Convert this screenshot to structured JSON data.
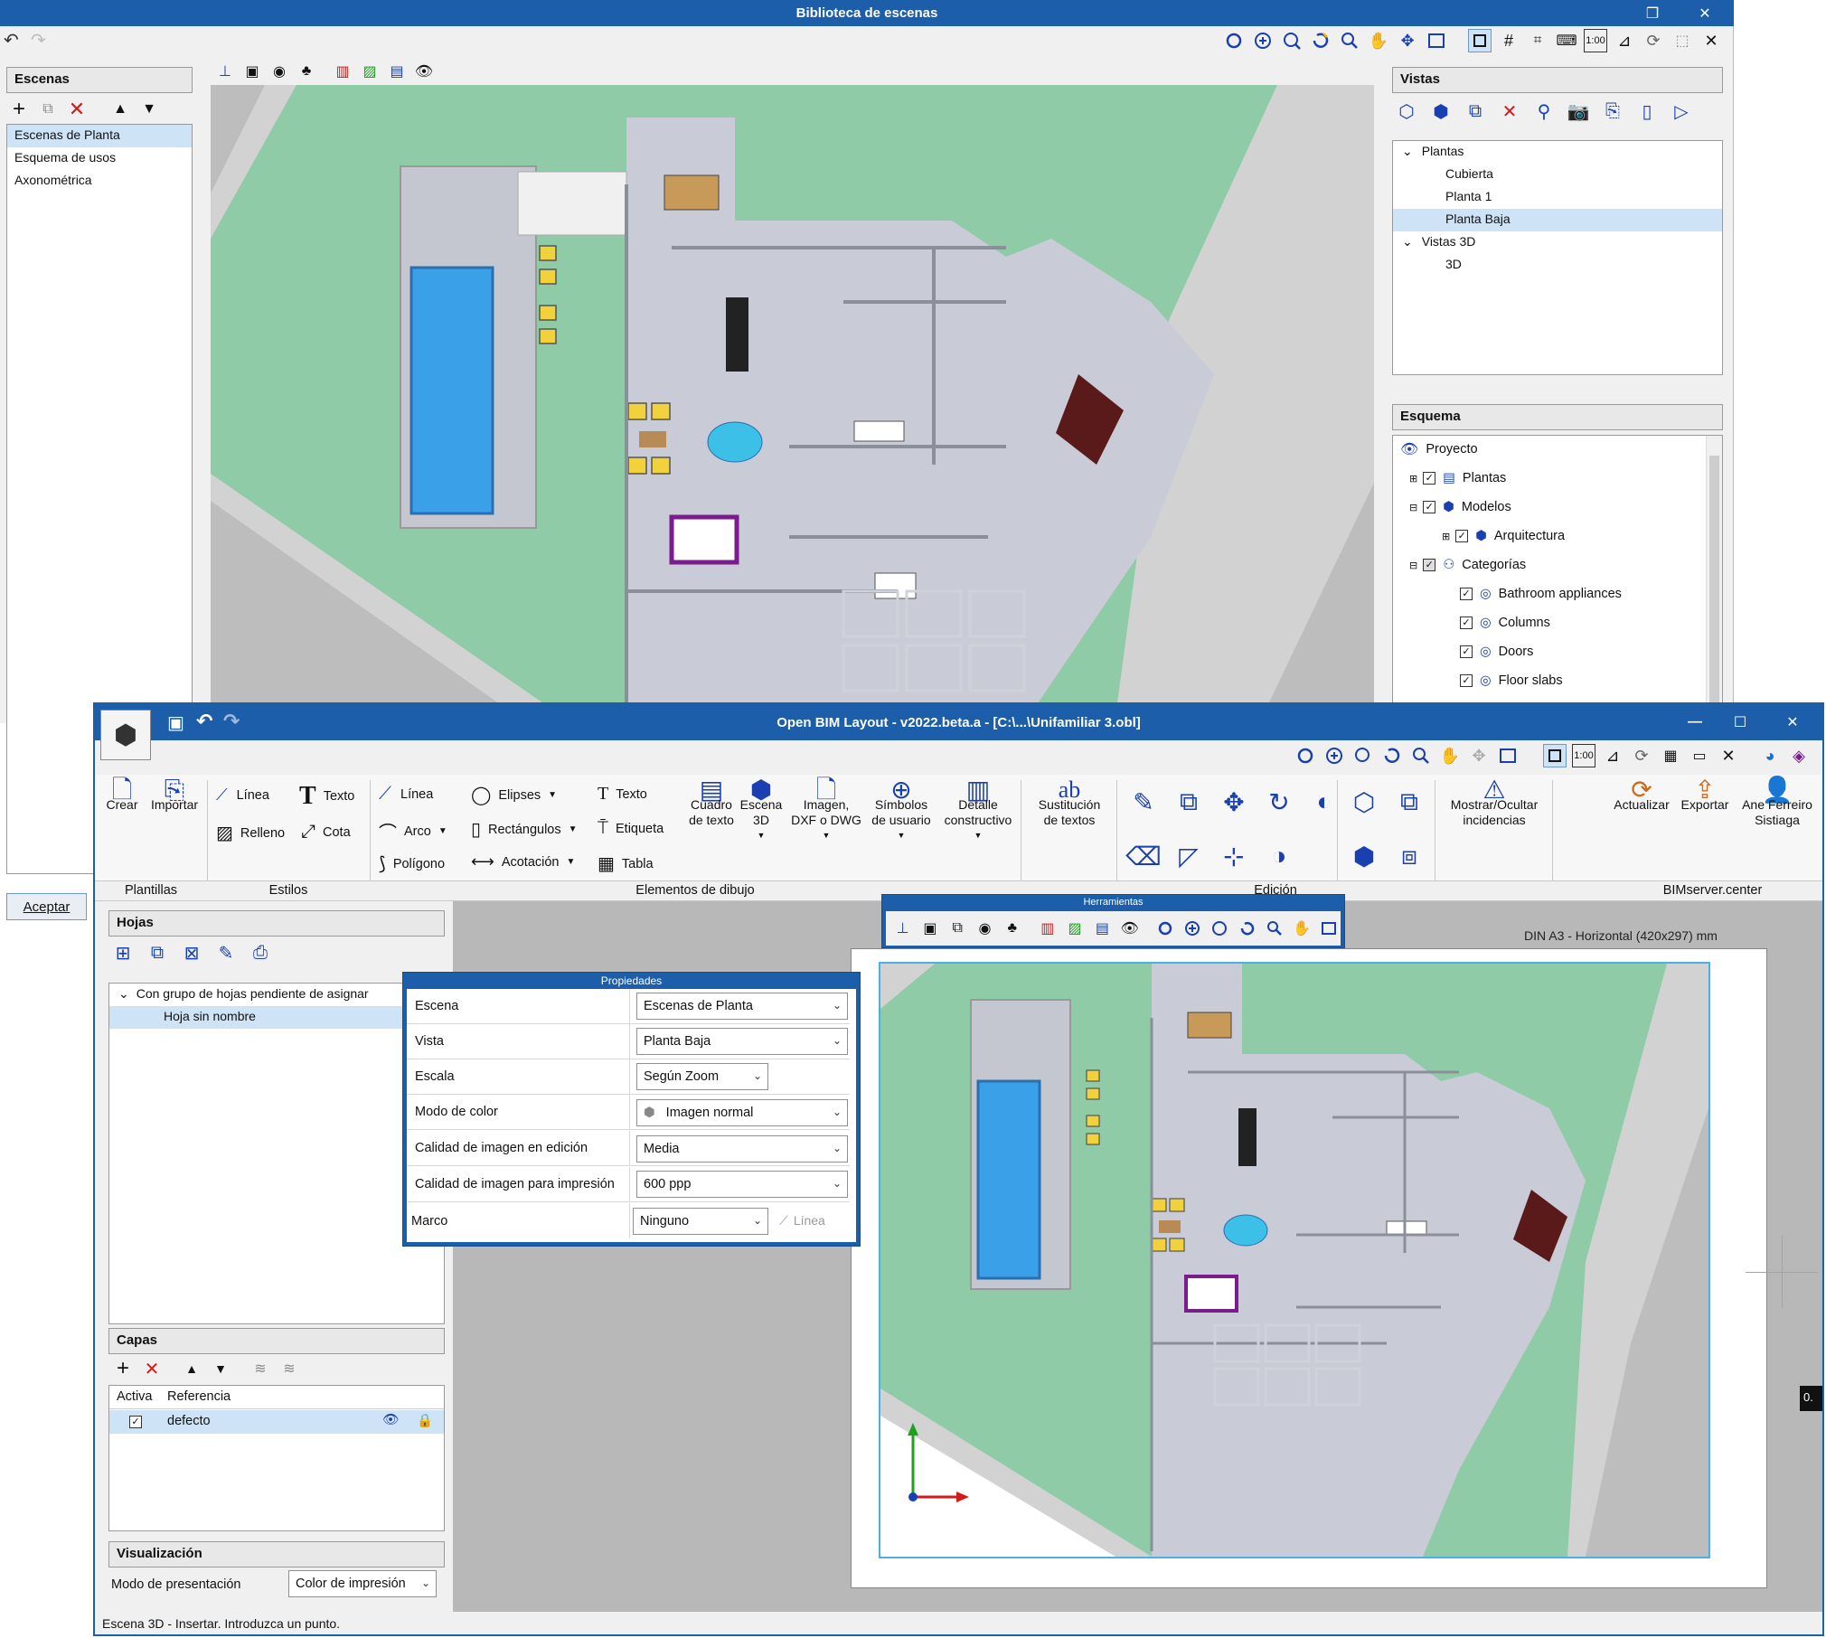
{
  "back_window": {
    "title": "Biblioteca de escenas",
    "escenas": {
      "header": "Escenas",
      "items": [
        "Escenas de Planta",
        "Esquema de usos",
        "Axonométrica"
      ],
      "selected_index": 0
    },
    "vistas": {
      "header": "Vistas",
      "tree": [
        {
          "label": "Plantas",
          "level": 0,
          "expanded": true
        },
        {
          "label": "Cubierta",
          "level": 1
        },
        {
          "label": "Planta 1",
          "level": 1
        },
        {
          "label": "Planta Baja",
          "level": 1,
          "selected": true
        },
        {
          "label": "Vistas 3D",
          "level": 0,
          "expanded": true
        },
        {
          "label": "3D",
          "level": 1
        }
      ]
    },
    "esquema": {
      "header": "Esquema",
      "root": "Proyecto",
      "items": [
        {
          "label": "Plantas",
          "level": 1
        },
        {
          "label": "Modelos",
          "level": 1
        },
        {
          "label": "Arquitectura",
          "level": 2
        },
        {
          "label": "Categorías",
          "level": 1
        },
        {
          "label": "Bathroom appliances",
          "level": 2
        },
        {
          "label": "Columns",
          "level": 2
        },
        {
          "label": "Doors",
          "level": 2
        },
        {
          "label": "Floor slabs",
          "level": 2
        }
      ]
    },
    "accept_label": "Aceptar"
  },
  "main_window": {
    "title": "Open BIM Layout - v2022.beta.a - [C:\\...\\Unifamiliar 3.obl]",
    "ribbon": {
      "plantillas": {
        "group": "Plantillas",
        "crear": "Crear",
        "importar": "Importar"
      },
      "estilos": {
        "group": "Estilos",
        "linea": "Línea",
        "texto": "Texto",
        "relleno": "Relleno",
        "cota": "Cota"
      },
      "elementos": {
        "group": "Elementos de dibujo",
        "linea": "Línea",
        "arco": "Arco",
        "poligono": "Polígono",
        "elipses": "Elipses",
        "rectangulos": "Rectángulos",
        "acotacion": "Acotación",
        "texto": "Texto",
        "etiqueta": "Etiqueta",
        "tabla": "Tabla",
        "cuadro_texto": [
          "Cuadro",
          "de texto"
        ],
        "escena_3d": [
          "Escena",
          "3D"
        ],
        "imagen": [
          "Imagen,",
          "DXF o DWG"
        ],
        "simbolos": [
          "Símbolos",
          "de usuario"
        ],
        "detalle": [
          "Detalle",
          "constructivo"
        ]
      },
      "sustitucion": [
        "Sustitución",
        "de textos"
      ],
      "edicion": {
        "group": "Edición"
      },
      "incidencias": [
        "Mostrar/Ocultar",
        "incidencias"
      ],
      "bimserver": {
        "group": "BIMserver.center",
        "actualizar": "Actualizar",
        "exportar": "Exportar",
        "user": [
          "Ane Ferreiro",
          "Sistiaga"
        ]
      }
    },
    "hojas": {
      "header": "Hojas",
      "group_label": "Con grupo de hojas pendiente de asignar",
      "item": "Hoja sin nombre"
    },
    "capas": {
      "header": "Capas",
      "columns": [
        "Activa",
        "Referencia"
      ],
      "rows": [
        {
          "name": "defecto",
          "active": true
        }
      ]
    },
    "visualizacion": {
      "header": "Visualización",
      "label": "Modo de presentación",
      "value": "Color de impresión"
    },
    "status": "Escena 3D - Insertar. Introduzca un punto.",
    "herramientas_title": "Herramientas",
    "sheet_label": "DIN A3 - Horizontal (420x297) mm",
    "side_value": "0.",
    "propiedades": {
      "title": "Propiedades",
      "rows": [
        {
          "label": "Escena",
          "value": "Escenas de Planta"
        },
        {
          "label": "Vista",
          "value": "Planta Baja"
        },
        {
          "label": "Escala",
          "value": "Según Zoom"
        },
        {
          "label": "Modo de color",
          "value": "Imagen normal"
        },
        {
          "label": "Calidad de imagen en edición",
          "value": "Media"
        },
        {
          "label": "Calidad de imagen para impresión",
          "value": "600 ppp"
        },
        {
          "label": "Marco",
          "value": "Ninguno"
        }
      ],
      "linea_label": "Línea"
    }
  },
  "colors": {
    "titlebar": "#1c5ea9",
    "grass": "#8ecba6",
    "interior": "#c9ccd6",
    "pool": "#3aa0e8",
    "road": "#cfcfcf",
    "selection": "#cfe3f7"
  }
}
